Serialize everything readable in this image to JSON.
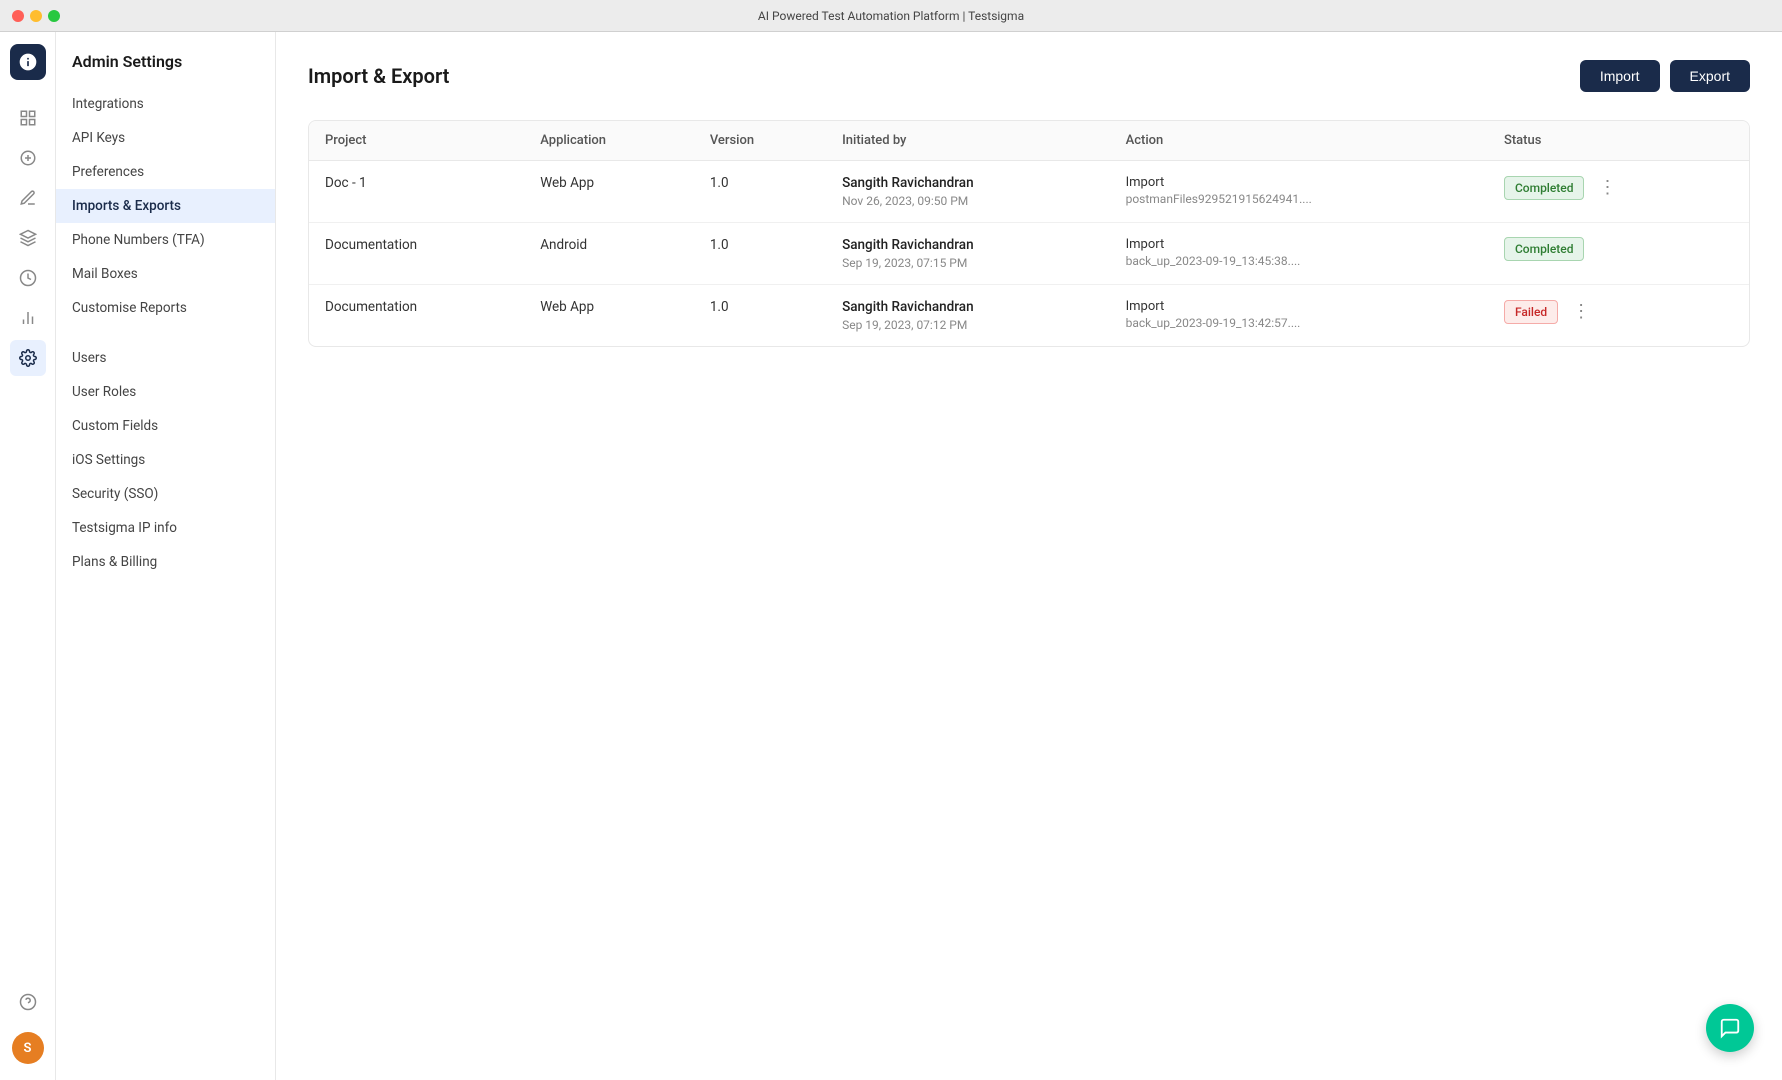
{
  "window": {
    "title": "AI Powered Test Automation Platform | Testsigma"
  },
  "icon_sidebar": {
    "logo_icon": "gear-icon",
    "nav_items": [
      {
        "name": "grid-icon",
        "icon": "grid"
      },
      {
        "name": "edit-icon",
        "icon": "edit"
      },
      {
        "name": "pen-icon",
        "icon": "pen"
      },
      {
        "name": "layers-icon",
        "icon": "layers"
      },
      {
        "name": "clock-icon",
        "icon": "clock"
      },
      {
        "name": "chart-icon",
        "icon": "chart"
      },
      {
        "name": "settings-active-icon",
        "icon": "settings"
      }
    ],
    "help_icon": "help-circle-icon",
    "avatar_label": "S"
  },
  "sidebar": {
    "title": "Admin Settings",
    "items": [
      {
        "label": "Integrations",
        "active": false
      },
      {
        "label": "API Keys",
        "active": false
      },
      {
        "label": "Preferences",
        "active": false
      },
      {
        "label": "Imports & Exports",
        "active": true
      },
      {
        "label": "Phone Numbers (TFA)",
        "active": false
      },
      {
        "label": "Mail Boxes",
        "active": false
      },
      {
        "label": "Customise Reports",
        "active": false
      },
      {
        "label": "Users",
        "active": false
      },
      {
        "label": "User Roles",
        "active": false
      },
      {
        "label": "Custom Fields",
        "active": false
      },
      {
        "label": "iOS Settings",
        "active": false
      },
      {
        "label": "Security (SSO)",
        "active": false
      },
      {
        "label": "Testsigma IP info",
        "active": false
      },
      {
        "label": "Plans & Billing",
        "active": false
      }
    ]
  },
  "page": {
    "title": "Import & Export",
    "import_button": "Import",
    "export_button": "Export"
  },
  "table": {
    "columns": [
      "Project",
      "Application",
      "Version",
      "Initiated by",
      "Action",
      "Status"
    ],
    "rows": [
      {
        "project": "Doc - 1",
        "application": "Web App",
        "version": "1.0",
        "initiated_name": "Sangith Ravichandran",
        "initiated_date": "Nov 26, 2023, 09:50 PM",
        "action_type": "Import",
        "action_file": "postmanFiles929521915624941....",
        "status": "Completed",
        "status_type": "completed",
        "has_menu": true
      },
      {
        "project": "Documentation",
        "application": "Android",
        "version": "1.0",
        "initiated_name": "Sangith Ravichandran",
        "initiated_date": "Sep 19, 2023, 07:15 PM",
        "action_type": "Import",
        "action_file": "back_up_2023-09-19_13:45:38....",
        "status": "Completed",
        "status_type": "completed",
        "has_menu": false
      },
      {
        "project": "Documentation",
        "application": "Web App",
        "version": "1.0",
        "initiated_name": "Sangith Ravichandran",
        "initiated_date": "Sep 19, 2023, 07:12 PM",
        "action_type": "Import",
        "action_file": "back_up_2023-09-19_13:42:57....",
        "status": "Failed",
        "status_type": "failed",
        "has_menu": true
      }
    ]
  }
}
